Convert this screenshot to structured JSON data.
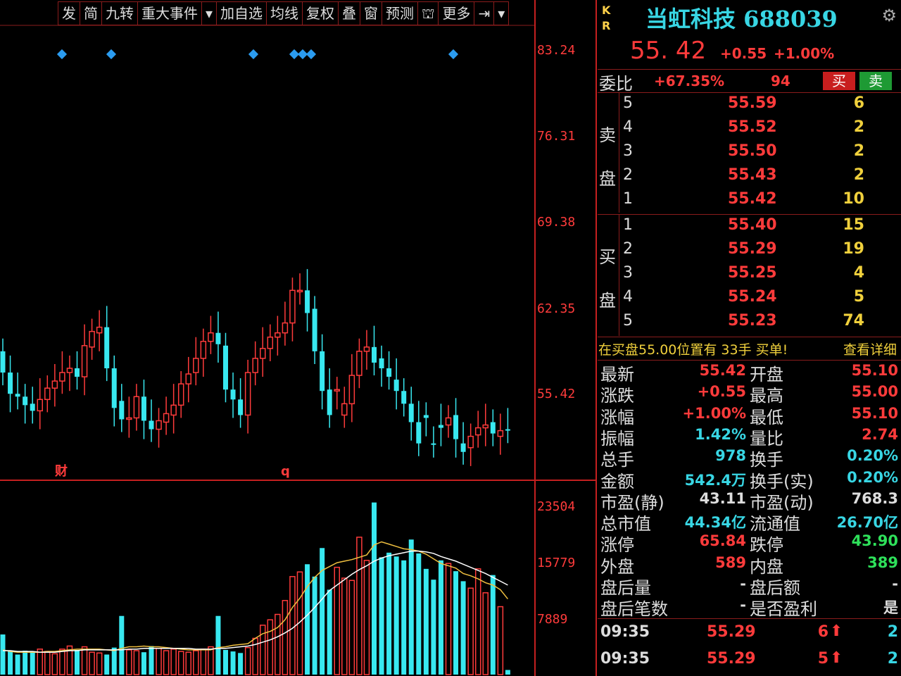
{
  "toolbar": [
    "发",
    "简",
    "九转",
    "重大事件",
    "▾",
    "加自选",
    "均线",
    "复权",
    "叠",
    "窗",
    "预测",
    "⛫",
    "更多",
    "⇥",
    "▾"
  ],
  "chart_labels": {
    "price_axis": [
      "83.24",
      "76.31",
      "69.38",
      "62.35",
      "55.42"
    ],
    "volume_axis": [
      "23504",
      "15779",
      "7889"
    ],
    "marker_cai": "财",
    "marker_q": "q"
  },
  "chart_data": [
    {
      "type": "candlestick",
      "open": [
        61.0,
        59.5,
        58.0,
        57.8,
        57.3,
        56.8,
        57.6,
        58.4,
        58.9,
        59.5,
        59.8,
        59.2,
        61.3,
        62.3,
        62.7,
        59.8,
        57.5,
        56.2,
        56.3,
        57.8,
        56.1,
        55.5,
        56.0,
        56.5,
        57.2,
        58.7,
        59.5,
        60.5,
        61.7,
        62.3,
        61.4,
        58.3,
        57.6,
        56.5,
        59.5,
        60.5,
        61.2,
        62.0,
        62.3,
        63.0,
        65.2,
        65.3,
        64.0,
        61.0,
        58.3,
        58.2,
        56.5,
        57.3,
        59.3,
        61.0,
        61.3,
        60.5,
        59.8,
        59.0,
        58.2,
        57.3,
        56.0,
        56.5,
        54.5,
        55.8,
        55.8,
        56.5,
        54.5,
        54.2,
        55.1,
        55.6,
        56.0,
        55.0,
        55.5
      ],
      "close": [
        59.5,
        58.0,
        57.8,
        57.2,
        56.8,
        57.6,
        58.4,
        58.9,
        59.5,
        59.8,
        59.2,
        61.4,
        62.4,
        62.7,
        59.8,
        57.0,
        56.2,
        56.3,
        57.8,
        56.1,
        55.5,
        56.1,
        56.6,
        57.2,
        58.7,
        59.4,
        60.5,
        61.7,
        62.3,
        61.5,
        58.3,
        57.6,
        56.5,
        59.5,
        60.5,
        61.2,
        62.0,
        62.3,
        63.0,
        65.3,
        65.3,
        63.7,
        61.0,
        58.2,
        56.5,
        58.3,
        57.3,
        59.3,
        61.0,
        61.3,
        60.2,
        59.8,
        59.2,
        58.2,
        57.3,
        56.0,
        54.5,
        56.3,
        54.4,
        55.6,
        56.3,
        54.8,
        53.9,
        55.0,
        55.6,
        55.8,
        55.2,
        55.4,
        55.42
      ],
      "price_range": [
        52.0,
        84.0
      ]
    },
    {
      "type": "bar",
      "values": [
        5200,
        3000,
        2600,
        3100,
        2900,
        3300,
        3000,
        2700,
        3300,
        3700,
        3200,
        3600,
        2900,
        2800,
        2600,
        3500,
        7600,
        3200,
        3100,
        2900,
        3700,
        3400,
        3100,
        3300,
        3000,
        2900,
        3100,
        3300,
        3600,
        7600,
        3200,
        3000,
        2800,
        3500,
        4700,
        6400,
        7100,
        7800,
        9600,
        12700,
        13300,
        14300,
        12700,
        16400,
        11000,
        13900,
        12500,
        12200,
        17800,
        14800,
        22300,
        15200,
        15800,
        15300,
        14800,
        17500,
        15700,
        13700,
        12300,
        14800,
        14400,
        13400,
        12100,
        11200,
        13700,
        10600,
        12900,
        8800,
        600
      ],
      "range": [
        0,
        25000
      ],
      "ma5": [
        3200,
        3000,
        2900,
        2900,
        2900,
        2900,
        3000,
        3000,
        3100,
        3200,
        3300,
        3300,
        3300,
        3300,
        3200,
        3100,
        3400,
        3600,
        3600,
        3700,
        3600,
        3600,
        3500,
        3400,
        3300,
        3200,
        3200,
        3200,
        3200,
        3500,
        3600,
        3800,
        3900,
        4000,
        4700,
        5300,
        5600,
        6100,
        7100,
        8700,
        9900,
        11400,
        12600,
        13500,
        14000,
        14500,
        14700,
        14900,
        15200,
        15500,
        16800,
        17200,
        16900,
        16600,
        16300,
        16200,
        16000,
        15600,
        15000,
        14400,
        14100,
        13800,
        13100,
        12800,
        12400,
        11900,
        11600,
        11000,
        9800
      ],
      "ma10": [
        3100,
        3100,
        3000,
        3000,
        3000,
        2900,
        2900,
        2900,
        3000,
        3100,
        3100,
        3200,
        3200,
        3200,
        3200,
        3200,
        3200,
        3300,
        3300,
        3400,
        3400,
        3400,
        3400,
        3400,
        3400,
        3400,
        3300,
        3300,
        3300,
        3400,
        3400,
        3500,
        3600,
        3700,
        3900,
        4200,
        4500,
        4900,
        5400,
        6000,
        6800,
        7700,
        8700,
        9800,
        10900,
        11600,
        12300,
        13000,
        13600,
        14100,
        14700,
        15100,
        15400,
        15600,
        15800,
        16000,
        16000,
        15900,
        15700,
        15300,
        15000,
        14700,
        14300,
        13900,
        13500,
        13100,
        12600,
        12100,
        11600
      ]
    }
  ],
  "quote": {
    "kr": [
      "K",
      "R"
    ],
    "title": "当虹科技 688039",
    "price": "55. 42",
    "change": "+0.55",
    "change_pct": "+1.00%"
  },
  "ratio": {
    "label": "委比",
    "value": "+67.35%",
    "diff": "94",
    "buy_label": "买",
    "sell_label": "卖"
  },
  "sell_side_label": [
    "卖",
    "盘"
  ],
  "buy_side_label": [
    "买",
    "盘"
  ],
  "asks": [
    {
      "level": "5",
      "price": "55.59",
      "vol": "6"
    },
    {
      "level": "4",
      "price": "55.52",
      "vol": "2"
    },
    {
      "level": "3",
      "price": "55.50",
      "vol": "2"
    },
    {
      "level": "2",
      "price": "55.43",
      "vol": "2"
    },
    {
      "level": "1",
      "price": "55.42",
      "vol": "10"
    }
  ],
  "bids": [
    {
      "level": "1",
      "price": "55.40",
      "vol": "15"
    },
    {
      "level": "2",
      "price": "55.29",
      "vol": "19"
    },
    {
      "level": "3",
      "price": "55.25",
      "vol": "4"
    },
    {
      "level": "4",
      "price": "55.24",
      "vol": "5"
    },
    {
      "level": "5",
      "price": "55.23",
      "vol": "74"
    }
  ],
  "notice": {
    "text": "在买盘55.00位置有 33手 买单!",
    "link": "查看详细"
  },
  "stats": [
    {
      "l1": "最新",
      "v1": "55.42",
      "c1": "#ff3b3b",
      "l2": "开盘",
      "v2": "55.10",
      "c2": "#ff3b3b"
    },
    {
      "l1": "涨跌",
      "v1": "+0.55",
      "c1": "#ff3b3b",
      "l2": "最高",
      "v2": "55.00",
      "c2": "#ff3b3b"
    },
    {
      "l1": "涨幅",
      "v1": "+1.00%",
      "c1": "#ff3b3b",
      "l2": "最低",
      "v2": "55.10",
      "c2": "#ff3b3b"
    },
    {
      "l1": "振幅",
      "v1": "1.42%",
      "c1": "#38d6e4",
      "l2": "量比",
      "v2": "2.74",
      "c2": "#ff3b3b"
    },
    {
      "l1": "总手",
      "v1": "978",
      "c1": "#38d6e4",
      "l2": "换手",
      "v2": "0.20%",
      "c2": "#38d6e4"
    },
    {
      "l1": "金额",
      "v1": "542.4万",
      "c1": "#38d6e4",
      "l2": "换手(实)",
      "v2": "0.20%",
      "c2": "#38d6e4"
    },
    {
      "l1": "市盈(静)",
      "v1": "43.11",
      "c1": "#dddddd",
      "l2": "市盈(动)",
      "v2": "768.3",
      "c2": "#dddddd"
    },
    {
      "l1": "总市值",
      "v1": "44.34亿",
      "c1": "#38d6e4",
      "l2": "流通值",
      "v2": "26.70亿",
      "c2": "#38d6e4"
    },
    {
      "l1": "涨停",
      "v1": "65.84",
      "c1": "#ff3b3b",
      "l2": "跌停",
      "v2": "43.90",
      "c2": "#2ee05a"
    },
    {
      "l1": "外盘",
      "v1": "589",
      "c1": "#ff3b3b",
      "l2": "内盘",
      "v2": "389",
      "c2": "#2ee05a"
    },
    {
      "l1": "盘后量",
      "v1": "-",
      "c1": "#dddddd",
      "l2": "盘后额",
      "v2": "-",
      "c2": "#dddddd"
    },
    {
      "l1": "盘后笔数",
      "v1": "-",
      "c1": "#dddddd",
      "l2": "是否盈利",
      "v2": "是",
      "c2": "#dddddd"
    }
  ],
  "trades": [
    {
      "time": "09:35",
      "price": "55.29",
      "vol": "6",
      "arrow": "⬆",
      "count": "2"
    },
    {
      "time": "09:35",
      "price": "55.29",
      "vol": "5",
      "arrow": "⬆",
      "count": "2"
    }
  ]
}
